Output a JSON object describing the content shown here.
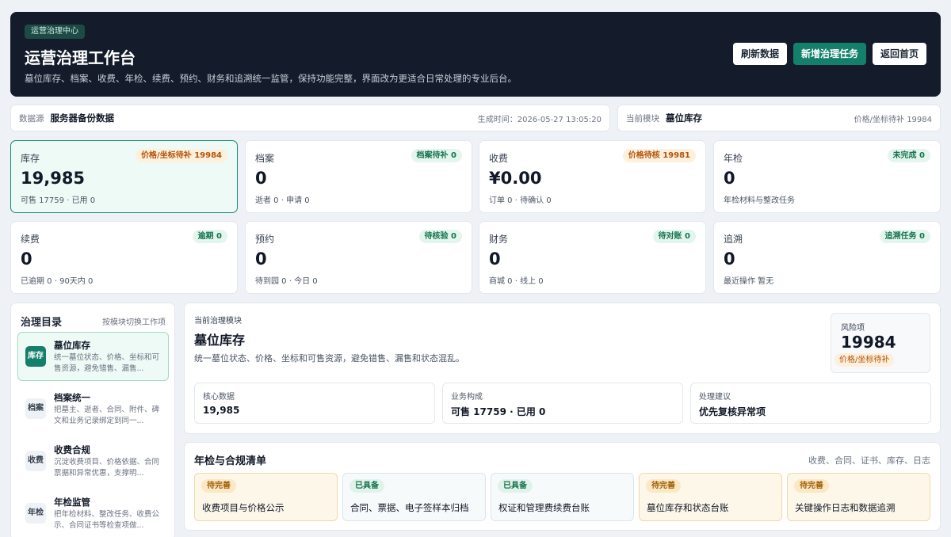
{
  "header": {
    "badge": "运营治理中心",
    "title": "运营治理工作台",
    "subtitle": "墓位库存、档案、收费、年检、续费、预约、财务和追溯统一监管，保持功能完整，界面改为更适合日常处理的专业后台。",
    "buttons": {
      "refresh": "刷新数据",
      "add_task": "新增治理任务",
      "home": "返回首页"
    }
  },
  "source_bar": {
    "key": "数据源",
    "value": "服务器备份数据",
    "generated": "生成时间：2026-05-27 13:05:20"
  },
  "module_bar": {
    "key": "当前模块",
    "value": "墓位库存",
    "note": "价格/坐标待补 19984"
  },
  "stats": [
    {
      "label": "库存",
      "tag": "价格/坐标待补 19984",
      "value": "19,985",
      "sub": "可售 17759 · 已用 0"
    },
    {
      "label": "档案",
      "tag": "档案待补 0",
      "value": "0",
      "sub": "逝者 0 · 申请 0"
    },
    {
      "label": "收费",
      "tag": "价格待核 19981",
      "value": "¥0.00",
      "sub": "订单 0 · 待确认 0"
    },
    {
      "label": "年检",
      "tag": "未完成 0",
      "value": "0",
      "sub": "年检材料与整改任务"
    },
    {
      "label": "续费",
      "tag": "逾期 0",
      "value": "0",
      "sub": "已逾期 0 · 90天内 0"
    },
    {
      "label": "预约",
      "tag": "待核验 0",
      "value": "0",
      "sub": "待到园 0 · 今日 0"
    },
    {
      "label": "财务",
      "tag": "待对账 0",
      "value": "0",
      "sub": "商城 0 · 线上 0"
    },
    {
      "label": "追溯",
      "tag": "追溯任务 0",
      "value": "0",
      "sub": "最近操作 暂无"
    }
  ],
  "sidebar": {
    "title": "治理目录",
    "hint": "按模块切换工作项",
    "items": [
      {
        "icon": "库存",
        "name": "墓位库存",
        "desc": "统一墓位状态、价格、坐标和可售资源，避免错售、漏售..."
      },
      {
        "icon": "档案",
        "name": "档案统一",
        "desc": "把墓主、逝者、合同、附件、碑文和业务记录绑定到同一..."
      },
      {
        "icon": "收费",
        "name": "收费合规",
        "desc": "沉淀收费项目、价格依据、合同票据和异常优惠，支撑明..."
      },
      {
        "icon": "年检",
        "name": "年检监管",
        "desc": "把年检材料、整改任务、收费公示、合同证书等检查项做..."
      }
    ]
  },
  "module_panel": {
    "eyebrow": "当前治理模块",
    "title": "墓位库存",
    "description": "统一墓位状态、价格、坐标和可售资源，避免错售、漏售和状态混乱。",
    "risk": {
      "label": "风险项",
      "value": "19984",
      "tag": "价格/坐标待补"
    },
    "metrics": [
      {
        "label": "核心数据",
        "value": "19,985"
      },
      {
        "label": "业务构成",
        "value": "可售 17759 · 已用 0"
      },
      {
        "label": "处理建议",
        "value": "优先复核异常项"
      }
    ]
  },
  "checklist": {
    "title": "年检与合规清单",
    "hint": "收费、合同、证书、库存、日志",
    "items": [
      {
        "status": "待完善",
        "label": "收费项目与价格公示"
      },
      {
        "status": "已具备",
        "label": "合同、票据、电子签样本归档"
      },
      {
        "status": "已具备",
        "label": "权证和管理费续费台账"
      },
      {
        "status": "待完善",
        "label": "墓位库存和状态台账"
      },
      {
        "status": "待完善",
        "label": "关键操作日志和数据追溯"
      }
    ]
  }
}
